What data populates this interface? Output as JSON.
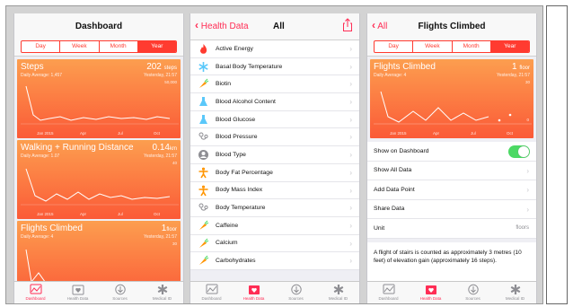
{
  "dashboard": {
    "title": "Dashboard",
    "segments": [
      "Day",
      "Week",
      "Month",
      "Year"
    ],
    "cards": [
      {
        "title": "Steps",
        "value": "202",
        "unit": "steps",
        "sub": "Daily Average: 1,457",
        "when": "Yesterday, 21:57",
        "max": "50,000",
        "xlabels": [
          "Jan 2015",
          "Apr",
          "Jul",
          "Oct"
        ]
      },
      {
        "title": "Walking + Running Distance",
        "value": "0.14",
        "unit": "km",
        "sub": "Daily Average: 1.07",
        "when": "Yesterday, 21:57",
        "max": "40",
        "xlabels": [
          "Jan 2015",
          "Apr",
          "Jul",
          "Oct"
        ]
      },
      {
        "title": "Flights Climbed",
        "value": "1",
        "unit": "floor",
        "sub": "Daily Average: 4",
        "when": "Yesterday, 21:57",
        "max": "30",
        "xlabels": []
      }
    ]
  },
  "tabs": [
    "Dashboard",
    "Health Data",
    "Sources",
    "Medical ID"
  ],
  "health_data": {
    "back": "Health Data",
    "title": "All",
    "items": [
      {
        "label": "Active Energy",
        "icon": "flame-icon"
      },
      {
        "label": "Basal Body Temperature",
        "icon": "snowflake-icon"
      },
      {
        "label": "Biotin",
        "icon": "carrot-icon"
      },
      {
        "label": "Blood Alcohol Content",
        "icon": "flask-icon"
      },
      {
        "label": "Blood Glucose",
        "icon": "flask-icon"
      },
      {
        "label": "Blood Pressure",
        "icon": "stethoscope-icon"
      },
      {
        "label": "Blood Type",
        "icon": "person-badge-icon"
      },
      {
        "label": "Body Fat Percentage",
        "icon": "body-icon"
      },
      {
        "label": "Body Mass Index",
        "icon": "body-icon"
      },
      {
        "label": "Body Temperature",
        "icon": "stethoscope-icon"
      },
      {
        "label": "Caffeine",
        "icon": "carrot-icon"
      },
      {
        "label": "Calcium",
        "icon": "carrot-icon"
      },
      {
        "label": "Carbohydrates",
        "icon": "carrot-icon"
      }
    ]
  },
  "flights": {
    "back": "All",
    "title": "Flights Climbed",
    "card": {
      "title": "Flights Climbed",
      "value": "1",
      "unit": "floor",
      "sub": "Daily Average: 4",
      "when": "Yesterday, 21:57",
      "max": "30",
      "min": "0",
      "xlabels": [
        "Jan 2015",
        "Apr",
        "Jul",
        "Oct"
      ]
    },
    "rows": [
      {
        "label": "Show on Dashboard"
      },
      {
        "label": "Show All Data"
      },
      {
        "label": "Add Data Point"
      },
      {
        "label": "Share Data"
      },
      {
        "label": "Unit",
        "value": "floors"
      }
    ],
    "description": "A flight of stairs is counted as approximately 3 metres (10 feet) of elevation gain (approximately 16 steps)."
  },
  "colors": {
    "accent": "#ff2d55",
    "orange_top": "#fc9e4f",
    "orange_bottom": "#fb5a37",
    "toggle_on": "#4cd964"
  }
}
